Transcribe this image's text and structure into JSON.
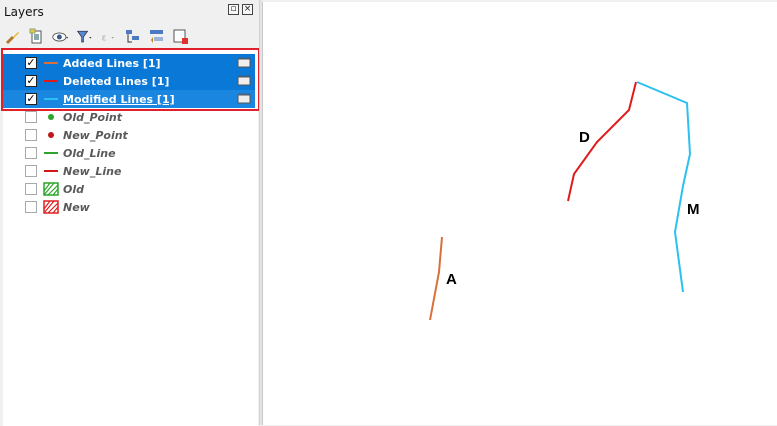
{
  "panel": {
    "title": "Layers"
  },
  "toolbar": {
    "icons": [
      "style-brush-icon",
      "add-group-icon",
      "visibility-eye-icon",
      "filter-icon",
      "expression-filter-icon",
      "expand-all-icon",
      "collapse-all-icon",
      "remove-layer-icon"
    ]
  },
  "layers": [
    {
      "name": "Added Lines [1]",
      "checked": true,
      "selected": true,
      "symbol": "line",
      "color": "#d9703a"
    },
    {
      "name": "Deleted Lines [1]",
      "checked": true,
      "selected": true,
      "symbol": "line",
      "color": "#e01a1a"
    },
    {
      "name": "Modified Lines [1]",
      "checked": true,
      "selected": true,
      "symbol": "line",
      "color": "#2cc0f0"
    },
    {
      "name": "Old_Point",
      "checked": false,
      "selected": false,
      "symbol": "point",
      "color": "#2aa52a"
    },
    {
      "name": "New_Point",
      "checked": false,
      "selected": false,
      "symbol": "point",
      "color": "#c01818"
    },
    {
      "name": "Old_Line",
      "checked": false,
      "selected": false,
      "symbol": "line",
      "color": "#2aa52a"
    },
    {
      "name": "New_Line",
      "checked": false,
      "selected": false,
      "symbol": "line",
      "color": "#d01818"
    },
    {
      "name": "Old",
      "checked": false,
      "selected": false,
      "symbol": "polygon",
      "color": "#2aa52a"
    },
    {
      "name": "New",
      "checked": false,
      "selected": false,
      "symbol": "polygon",
      "color": "#e02020"
    }
  ],
  "map": {
    "labels": {
      "a": "A",
      "d": "D",
      "m": "M"
    },
    "colors": {
      "added": "#d9703a",
      "deleted": "#e01a1a",
      "modified": "#2cc0f0"
    }
  }
}
